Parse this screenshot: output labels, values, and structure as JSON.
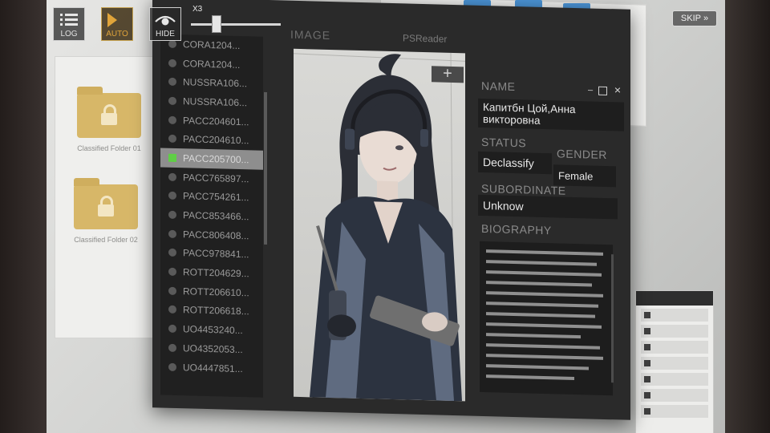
{
  "hud": {
    "log_label": "LOG",
    "auto_label": "AUTO",
    "hide_label": "HIDE",
    "speed_label": "X3",
    "skip_label": "SKIP",
    "auto_color": "#e0a43a"
  },
  "background": {
    "folders": [
      {
        "label": "Classified Folder 01"
      },
      {
        "label": "Classified Folder 02"
      }
    ],
    "folder_color": "#d7b768",
    "file_color": "#4b94d6"
  },
  "window": {
    "title": "PSReader",
    "image_header": "IMAGE",
    "add_label": "+",
    "list": [
      {
        "code": "CORA1204..."
      },
      {
        "code": "CORA1204..."
      },
      {
        "code": "NUSSRA106..."
      },
      {
        "code": "NUSSRA106..."
      },
      {
        "code": "PACC204601..."
      },
      {
        "code": "PACC204610..."
      },
      {
        "code": "PACC205700...",
        "active": true
      },
      {
        "code": "PACC765897..."
      },
      {
        "code": "PACC754261..."
      },
      {
        "code": "PACC853466..."
      },
      {
        "code": "PACC806408..."
      },
      {
        "code": "PACC978841..."
      },
      {
        "code": "ROTT204629..."
      },
      {
        "code": "ROTT206610..."
      },
      {
        "code": "ROTT206618..."
      },
      {
        "code": "UO4453240..."
      },
      {
        "code": "UO4352053..."
      },
      {
        "code": "UO4447851..."
      }
    ],
    "active_color": "#5fce45",
    "info": {
      "name_label": "NAME",
      "name_value": "Капитбн Цой,Анна викторовна",
      "status_label": "STATUS",
      "status_value": "Declassify",
      "gender_label": "GENDER",
      "gender_value": "Female",
      "subordinate_label": "SUBORDINATE",
      "subordinate_value": "Unknow",
      "biography_label": "BIOGRAPHY"
    }
  }
}
